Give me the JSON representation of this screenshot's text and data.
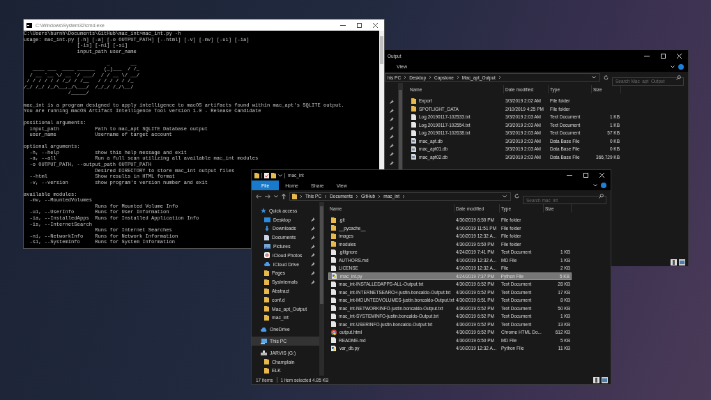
{
  "cmd_window": {
    "title": "C:\\Windows\\System32\\cmd.exe",
    "blocks": [
      [
        "C:\\Users\\burnh\\Documents\\GitHub\\mac_int>mac_int.py -h",
        "usage: mac_int.py [-h] [-a] [-o OUTPUT_PATH] [--html] [-v] [-mv] [-ui] [-ia]",
        "                  [-is] [-ni] [-si]",
        "                  input_path user_name"
      ],
      [
        "                            _       __",
        "   ____ ___  ____ ______   (_)___  / /_",
        "  / __ `__ \\/ __ `/ ___/  / / __ \\/ __/",
        " / / / / / / /_/ / /__   / / / / / /_",
        "/_/ /_/ /_/\\__,_/\\___/  /_/_/ /_/\\__/",
        "               /_____/"
      ],
      [
        "mac_int is a program designed to apply intelligence to macOS artifacts found within mac_apt's SQLITE output.",
        "You are running macOS Artifact Intelligence Tool version 1.0 - Release Candidate"
      ],
      [
        "positional arguments:",
        "  input_path            Path to mac_apt SQLITE Database output",
        "  user_name             Username of target account"
      ],
      [
        "optional arguments:",
        "  -h, --help            show this help message and exit",
        "  -a, --all             Run a full scan utilizing all available mac_int modules",
        "  -o OUTPUT_PATH, --output_path OUTPUT_PATH",
        "                        Desired DIRECTORY to store mac_int output files",
        "  --html                Show results in HTML format",
        "  -v, --version         show program's version number and exit"
      ],
      [
        "available modules:",
        "  -mv, --MountedVolumes",
        "                        Runs for Mounted Volume Info",
        "  -ui, --UserInfo       Runs for User Information",
        "  -ia, --InstalledApps  Runs for Installed Application Info",
        "  -is, --InternetSearch",
        "                        Runs for Internet Searches",
        "  -ni, --NetworkInfo    Runs for Network Information",
        "  -si, --SystemInfo     Runs for System Information"
      ]
    ]
  },
  "back_explorer": {
    "title": "Output",
    "ribbon_tabs": [
      {
        "label": "View",
        "selected": false
      }
    ],
    "breadcrumb": [
      "his PC",
      "Desktop",
      "Capstone",
      "Mac_apt_Output"
    ],
    "search": {
      "placeholder": "Search Mac_apt_Output"
    },
    "columns": [
      "Name",
      "Date modified",
      "Type",
      "Size"
    ],
    "rows": [
      {
        "name": "Export",
        "date": "3/3/2019 2:02 AM",
        "type": "File folder",
        "kind": "folder"
      },
      {
        "name": "SPOTLIGHT_DATA",
        "date": "2/10/2019 4:25 PM",
        "type": "File folder",
        "kind": "folder"
      },
      {
        "name": "Log.20190117-102533.txt",
        "date": "3/3/2019 2:03 AM",
        "type": "Text Document",
        "size": "1 KB",
        "kind": "text"
      },
      {
        "name": "Log.20190117-102554.txt",
        "date": "3/3/2019 2:03 AM",
        "type": "Text Document",
        "size": "1 KB",
        "kind": "text"
      },
      {
        "name": "Log.20190117-102638.txt",
        "date": "3/3/2019 2:03 AM",
        "type": "Text Document",
        "size": "57 KB",
        "kind": "text"
      },
      {
        "name": "mac_apt.db",
        "date": "3/3/2019 2:03 AM",
        "type": "Data Base File",
        "size": "0 KB",
        "kind": "db"
      },
      {
        "name": "mac_apt01.db",
        "date": "3/3/2019 2:03 AM",
        "type": "Data Base File",
        "size": "0 KB",
        "kind": "db"
      },
      {
        "name": "mac_apt02.db",
        "date": "3/3/2019 2:03 AM",
        "type": "Data Base File",
        "size": "366,729 KB",
        "kind": "db"
      }
    ]
  },
  "front_explorer": {
    "title": "mac_int",
    "ribbon_tabs": [
      {
        "label": "File",
        "selected": true
      },
      {
        "label": "Home",
        "selected": false
      },
      {
        "label": "Share",
        "selected": false
      },
      {
        "label": "View",
        "selected": false
      }
    ],
    "breadcrumb": [
      "This PC",
      "Documents",
      "GitHub",
      "mac_int"
    ],
    "search": {
      "placeholder": "Search mac_int"
    },
    "nav": [
      {
        "label": "Quick access",
        "kind": "star",
        "selected": false,
        "children": [
          {
            "label": "Desktop",
            "kind": "desktop",
            "pinned": true,
            "selected": false
          },
          {
            "label": "Downloads",
            "kind": "download",
            "pinned": true,
            "selected": false
          },
          {
            "label": "Documents",
            "kind": "document",
            "pinned": true,
            "selected": false
          },
          {
            "label": "Pictures",
            "kind": "picture",
            "pinned": true,
            "selected": false
          },
          {
            "label": "iCloud Photos",
            "kind": "photos",
            "pinned": true,
            "selected": false
          },
          {
            "label": "iCloud Drive",
            "kind": "cloud",
            "pinned": true,
            "selected": false
          },
          {
            "label": "Pages",
            "kind": "folder",
            "pinned": true,
            "selected": false
          },
          {
            "label": "Sysinternals",
            "kind": "folder",
            "pinned": true,
            "selected": false
          },
          {
            "label": "Abstract",
            "kind": "folder",
            "pinned": false,
            "selected": false
          },
          {
            "label": "conf.d",
            "kind": "folder",
            "pinned": false,
            "selected": false
          },
          {
            "label": "Mac_apt_Output",
            "kind": "folder",
            "pinned": false,
            "selected": false
          },
          {
            "label": "mac_int",
            "kind": "folder",
            "pinned": false,
            "selected": false
          }
        ]
      },
      {
        "label": "OneDrive",
        "kind": "cloud",
        "selected": false
      },
      {
        "label": "This PC",
        "kind": "computer",
        "selected": true
      },
      {
        "label": "JARVIS (G:)",
        "kind": "drive",
        "selected": false,
        "children": [
          {
            "label": "Champlain",
            "kind": "folder",
            "pinned": false,
            "selected": false
          },
          {
            "label": "ELK",
            "kind": "folder",
            "pinned": false,
            "selected": false
          }
        ]
      }
    ],
    "columns": [
      "Name",
      "Date modified",
      "Type",
      "Size"
    ],
    "rows": [
      {
        "name": ".git",
        "date": "4/30/2019 6:50 PM",
        "type": "File folder",
        "kind": "folder",
        "selected": false
      },
      {
        "name": "__pycache__",
        "date": "4/10/2019 11:51 PM",
        "type": "File folder",
        "kind": "folder",
        "selected": false
      },
      {
        "name": "images",
        "date": "4/10/2019 12:32 A...",
        "type": "File folder",
        "kind": "folder",
        "selected": false
      },
      {
        "name": "modules",
        "date": "4/30/2019 6:50 PM",
        "type": "File folder",
        "kind": "folder",
        "selected": false
      },
      {
        "name": ".gitignore",
        "date": "4/24/2019 7:41 PM",
        "type": "Text Document",
        "size": "1 KB",
        "kind": "text",
        "selected": false
      },
      {
        "name": "AUTHORS.md",
        "date": "4/10/2019 12:32 A...",
        "type": "MD File",
        "size": "1 KB",
        "kind": "text",
        "selected": false
      },
      {
        "name": "LICENSE",
        "date": "4/10/2019 12:32 A...",
        "type": "File",
        "size": "2 KB",
        "kind": "text",
        "selected": false
      },
      {
        "name": "mac_int.py",
        "date": "4/24/2019 7:37 PM",
        "type": "Python File",
        "size": "5 KB",
        "kind": "python",
        "selected": true
      },
      {
        "name": "mac_int-INSTALLEDAPPS-ALL-Output.txt",
        "date": "4/30/2019 6:52 PM",
        "type": "Text Document",
        "size": "28 KB",
        "kind": "text",
        "selected": false
      },
      {
        "name": "mac_int-INTERNETSEARCH-justin.boncaldo-Output.txt",
        "date": "4/30/2019 6:52 PM",
        "type": "Text Document",
        "size": "17 KB",
        "kind": "text",
        "selected": false
      },
      {
        "name": "mac_int-MOUNTEDVOLUMES-justin.boncaldo-Output.txt",
        "date": "4/30/2019 6:51 PM",
        "type": "Text Document",
        "size": "8 KB",
        "kind": "text",
        "selected": false
      },
      {
        "name": "mac_int-NETWORKINFO-justin.boncaldo-Output.txt",
        "date": "4/30/2019 6:52 PM",
        "type": "Text Document",
        "size": "50 KB",
        "kind": "text",
        "selected": false
      },
      {
        "name": "mac_int-SYSTEMINFO-justin.boncaldo-Output.txt",
        "date": "4/30/2019 6:52 PM",
        "type": "Text Document",
        "size": "1 KB",
        "kind": "text",
        "selected": false
      },
      {
        "name": "mac_int-USERINFO-justin.boncaldo-Output.txt",
        "date": "4/30/2019 6:52 PM",
        "type": "Text Document",
        "size": "13 KB",
        "kind": "text",
        "selected": false
      },
      {
        "name": "output.html",
        "date": "4/30/2019 6:52 PM",
        "type": "Chrome HTML Do...",
        "size": "612 KB",
        "kind": "chrome",
        "selected": false
      },
      {
        "name": "README.md",
        "date": "4/30/2019 6:50 PM",
        "type": "MD File",
        "size": "5 KB",
        "kind": "text",
        "selected": false
      },
      {
        "name": "var_db.py",
        "date": "4/10/2019 12:32 A...",
        "type": "Python File",
        "size": "11 KB",
        "kind": "python",
        "selected": false
      }
    ],
    "status": {
      "item_count": "17 items",
      "selection": "1 item selected  4.85 KB"
    }
  }
}
